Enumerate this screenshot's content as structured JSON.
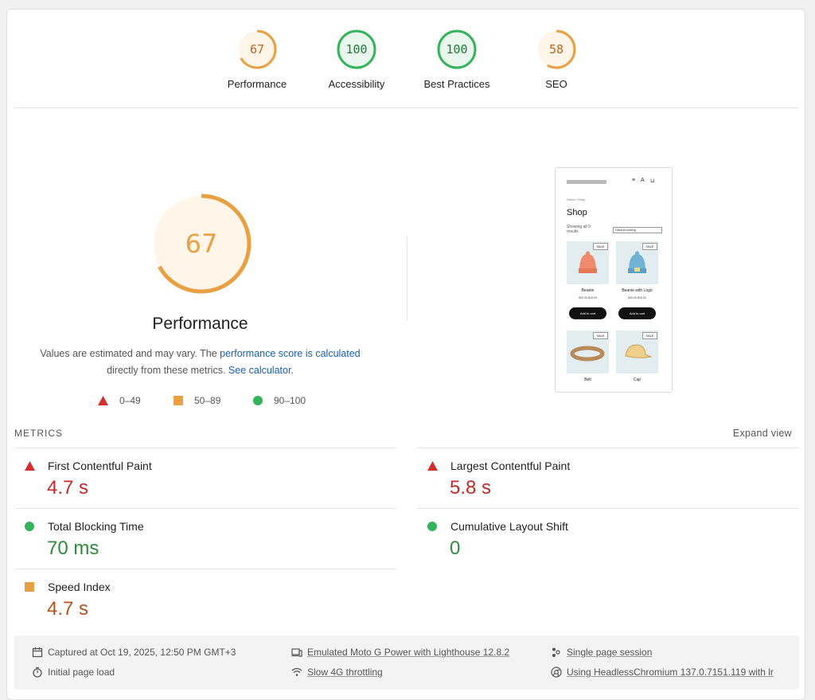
{
  "colors": {
    "fail": "#c62828",
    "average": "#e8a042",
    "pass": "#2e9d45",
    "link": "#1a5fb4"
  },
  "scores": [
    {
      "label": "Performance",
      "value": "67",
      "color": "#e8a042",
      "fraction": 0.67
    },
    {
      "label": "Accessibility",
      "value": "100",
      "color": "#34b35a",
      "fraction": 1.0
    },
    {
      "label": "Best Practices",
      "value": "100",
      "color": "#34b35a",
      "fraction": 1.0
    },
    {
      "label": "SEO",
      "value": "58",
      "color": "#e8a042",
      "fraction": 0.58
    }
  ],
  "performance": {
    "score": "67",
    "fraction": 0.67,
    "title": "Performance",
    "desc_text1": "Values are estimated and may vary. The ",
    "desc_link1": "performance score is calculated",
    "desc_text2": "directly from these metrics. ",
    "desc_link2": "See calculator",
    "desc_text3": "."
  },
  "legend": [
    {
      "label": "0–49",
      "icon": "triangle-icon"
    },
    {
      "label": "50–89",
      "icon": "square-icon"
    },
    {
      "label": "90–100",
      "icon": "circle-icon"
    }
  ],
  "screenshot": {
    "page_title": "Shop",
    "breadcrumb": "Home / Shop",
    "result_count": "Showing all 9 results",
    "sorting": "Default sorting",
    "sale_label": "SALE",
    "products": [
      {
        "name": "Beanie",
        "price": "$20.00 $18.00",
        "button": "Add to cart",
        "icon": "beanie-icon"
      },
      {
        "name": "Beanie with Logo",
        "price": "$20.00 $18.00",
        "button": "Add to cart",
        "icon": "beanie-logo-icon"
      },
      {
        "name": "Belt",
        "price": "",
        "icon": "belt-icon"
      },
      {
        "name": "Cap",
        "price": "",
        "icon": "cap-icon"
      }
    ]
  },
  "metrics_header": "METRICS",
  "expand_view": "Expand view",
  "metrics": [
    {
      "title": "First Contentful Paint",
      "value": "4.7 s",
      "status": "fail",
      "icon": "triangle-icon"
    },
    {
      "title": "Largest Contentful Paint",
      "value": "5.8 s",
      "status": "fail",
      "icon": "triangle-icon"
    },
    {
      "title": "Total Blocking Time",
      "value": "70 ms",
      "status": "pass",
      "icon": "circle-icon"
    },
    {
      "title": "Cumulative Layout Shift",
      "value": "0",
      "status": "pass",
      "icon": "circle-icon"
    },
    {
      "title": "Speed Index",
      "value": "4.7 s",
      "status": "average",
      "icon": "square-icon"
    }
  ],
  "footer": {
    "captured": "Captured at Oct 19, 2025, 12:50 PM GMT+3",
    "initial_load": "Initial page load",
    "emulated": "Emulated Moto G Power with Lighthouse 12.8.2",
    "throttling": "Slow 4G throttling",
    "session": "Single page session",
    "browser": "Using HeadlessChromium 137.0.7151.119 with lr"
  }
}
